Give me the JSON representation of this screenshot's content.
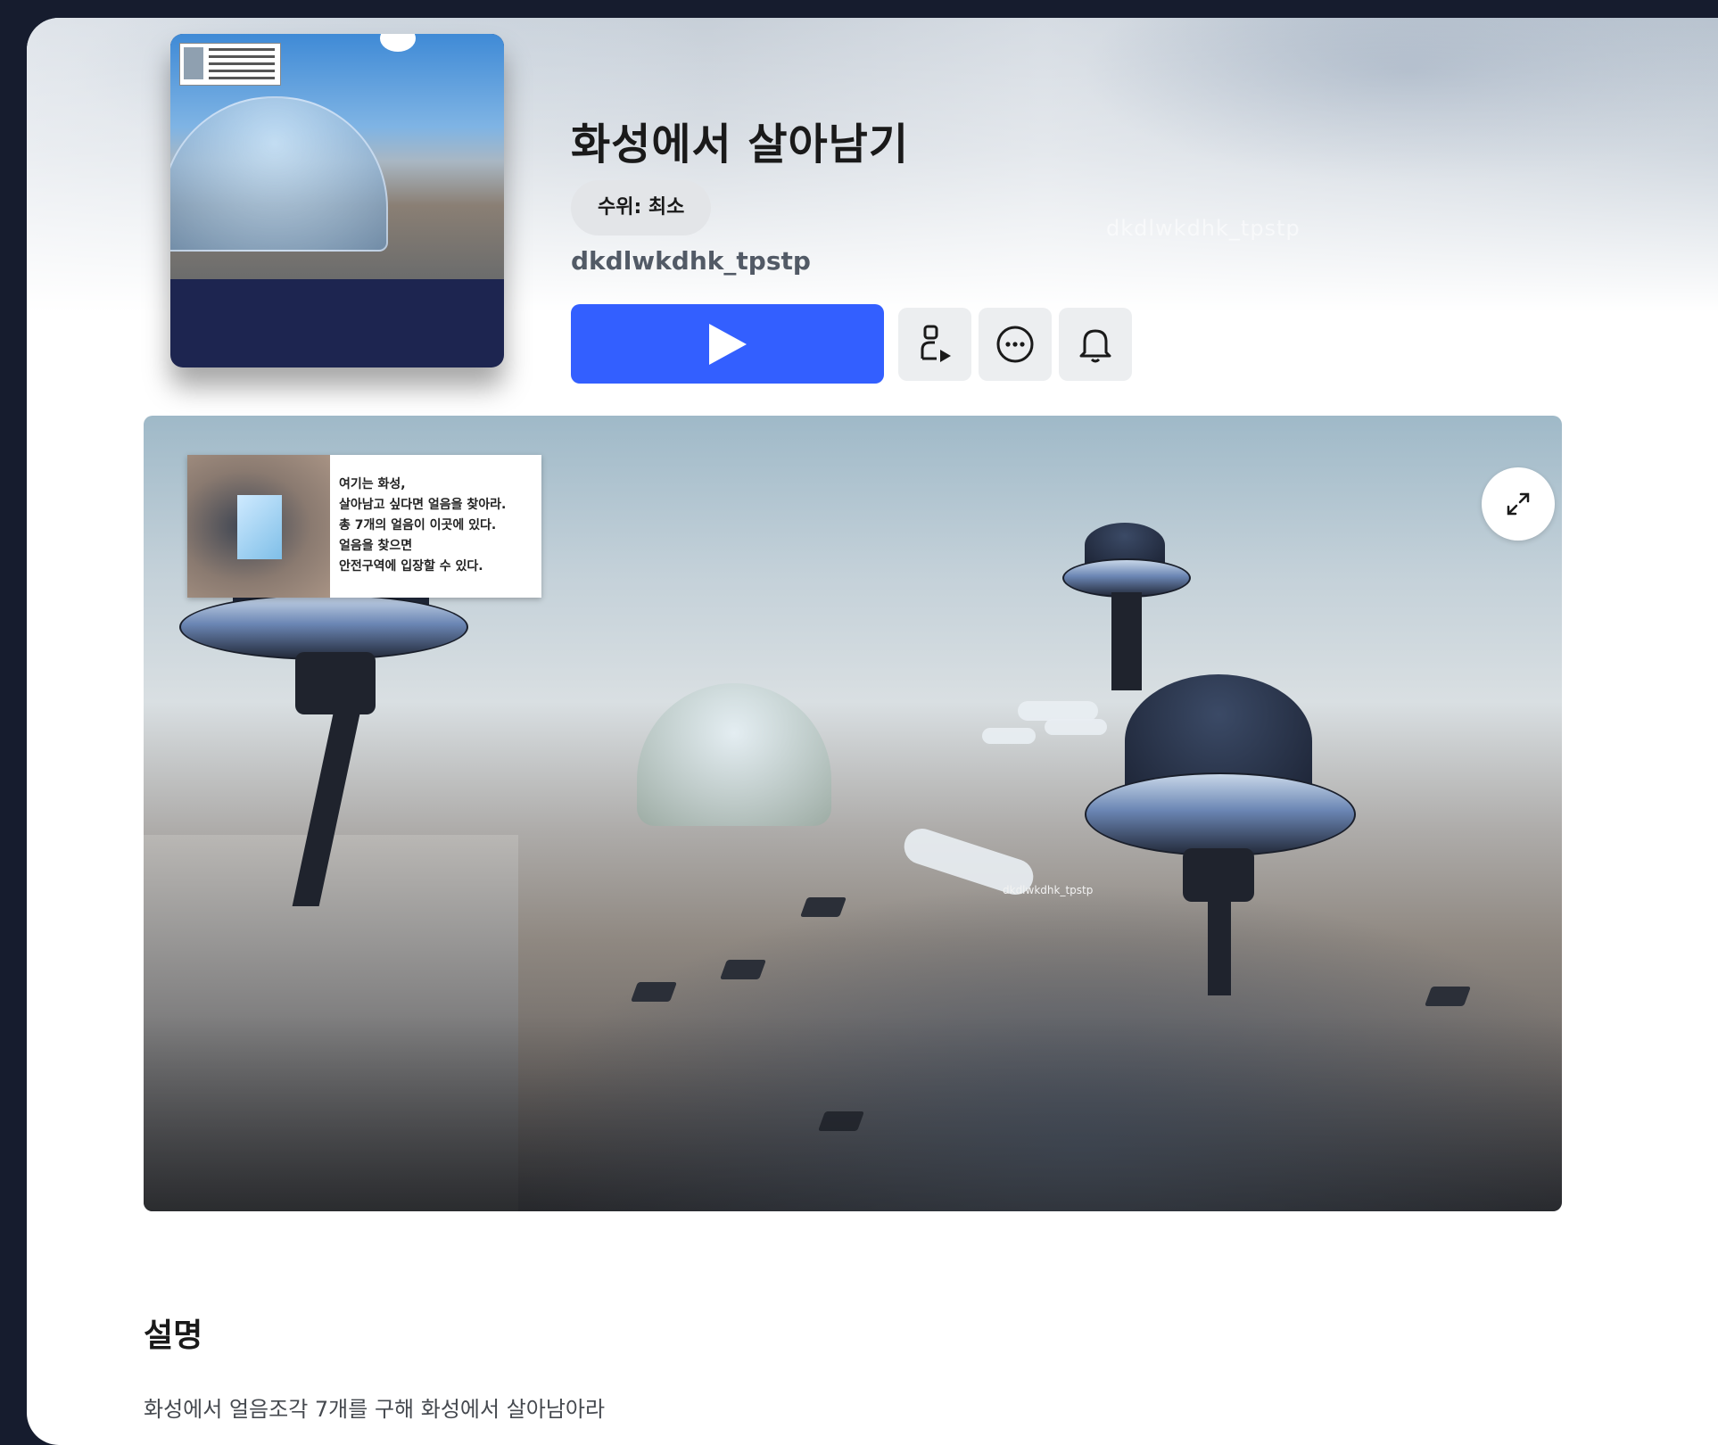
{
  "experience": {
    "title": "화성에서 살아남기",
    "maturity_badge": "수위: 최소",
    "creator": "dkdlwkdhk_tpstp"
  },
  "actions": {
    "play": "play-icon",
    "avatar": "avatar-play-icon",
    "more": "more-icon",
    "notify": "bell-icon"
  },
  "media": {
    "info_card_lines": [
      "여기는 화성,",
      "살아남고 싶다면 얼음을 찾아라.",
      "총 7개의 얼음이 이곳에 있다.",
      "얼음을 찾으면",
      "안전구역에 입장할 수 있다."
    ],
    "player_tag": "dkdlwkdhk_tpstp",
    "expand": "expand-icon"
  },
  "description": {
    "heading": "설명",
    "text": "화성에서 얼음조각 7개를 구해 화성에서 살아남아라"
  },
  "colors": {
    "primary": "#335fff",
    "background": "#161c2e",
    "panel": "#ffffff"
  }
}
